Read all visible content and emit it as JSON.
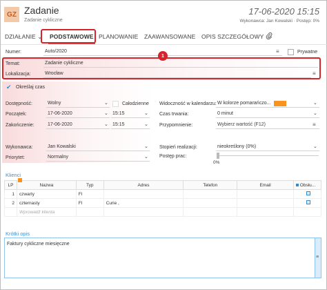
{
  "header": {
    "avatar_initials": "GZ",
    "title": "Zadanie",
    "subtitle": "Zadanie cykliczne",
    "date": "17-06-2020 15:15",
    "meta": "Wykonawca: Jan Kowalski · Postęp: 0%"
  },
  "tabs": {
    "action": "DZIAŁANIE",
    "basic": "PODSTAWOWE",
    "planning": "PLANOWANIE",
    "advanced": "ZAAWANSOWANE",
    "detailed": "OPIS SZCZEGÓŁOWY",
    "attachment_icon": "paperclip-icon"
  },
  "annotation": {
    "badge": "1",
    "color": "#d8232a"
  },
  "form": {
    "number_label": "Numer:",
    "number_value": "Auto/2020",
    "private_label": "Prywatne",
    "subject_label": "Temat:",
    "subject_value": "Zadanie cykliczne",
    "location_label": "Lokalizacja:",
    "location_value": "Wrocław",
    "specify_time_label": "Określaj czas",
    "availability_label": "Dostępność:",
    "availability_value": "Wolny",
    "allday_label": "Całodzienne",
    "start_label": "Początek:",
    "start_date": "17-06-2020",
    "start_time": "15:15",
    "end_label": "Zakończenie:",
    "end_date": "17-06-2020",
    "end_time": "15:15",
    "calendar_visibility_label": "Widoczność w kalendarzu:",
    "calendar_visibility_value": "W kolorze pomarańczo...",
    "calendar_color": "#f7931e",
    "duration_label": "Czas trwania:",
    "duration_value": "0 minut",
    "reminder_label": "Przypomnienie:",
    "reminder_value": "Wybierz wartość (F12)",
    "executor_label": "Wykonawca:",
    "executor_value": "Jan Kowalski",
    "priority_label": "Priorytet:",
    "priority_value": "Normalny",
    "realization_label": "Stopień realizacji:",
    "realization_value": "nieokreślony  (0%)",
    "progress_label": "Postęp prac:",
    "progress_value": "0%",
    "progress_fraction": 0
  },
  "clients": {
    "section_label": "Klienci",
    "columns": [
      "LP",
      "Nazwa",
      "Typ",
      "Adres",
      "Telefon",
      "Email",
      "Obsłu..."
    ],
    "rows": [
      {
        "lp": "1",
        "name": "czwarty",
        "type": "FI",
        "address": "",
        "phone": "",
        "email": ""
      },
      {
        "lp": "2",
        "name": "czternasty",
        "type": "FI",
        "address": "Curie ,",
        "phone": "",
        "email": ""
      }
    ],
    "placeholder": "Wprowadź klienta"
  },
  "description": {
    "section_label": "Krótki opis",
    "value": "Faktury cykliczne miesięczne"
  }
}
